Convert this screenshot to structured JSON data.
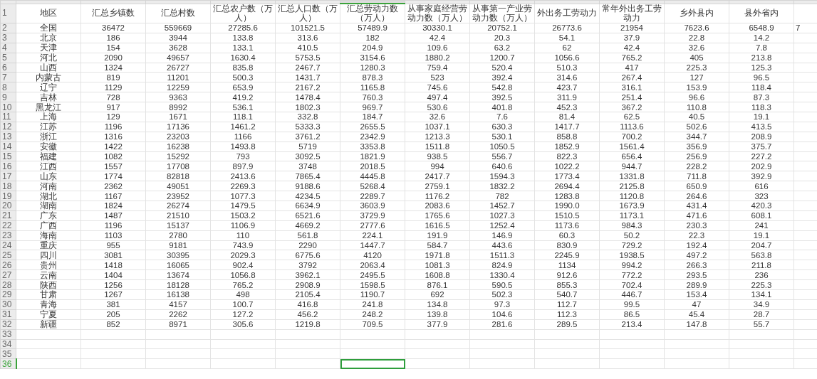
{
  "columns": [
    {
      "title": "地区",
      "selected": false
    },
    {
      "title": "汇总乡镇数",
      "selected": false
    },
    {
      "title": "汇总村数",
      "selected": false
    },
    {
      "title": "汇总农户数（万人）",
      "selected": false
    },
    {
      "title": "汇总人口数（万人）",
      "selected": false
    },
    {
      "title": "汇总劳动力数（万人）",
      "selected": true
    },
    {
      "title": "从事家庭经营劳动力数（万人）",
      "selected": false
    },
    {
      "title": "从事第一产业劳动力数（万人）",
      "selected": false
    },
    {
      "title": "外出务工劳动力",
      "selected": false
    },
    {
      "title": "常年外出务工劳动力",
      "selected": false
    },
    {
      "title": "乡外县内",
      "selected": false
    },
    {
      "title": "县外省内",
      "selected": false
    }
  ],
  "header_row_number": "1",
  "rows": [
    {
      "number": "2",
      "selected": false,
      "cells": [
        "全国",
        "36472",
        "559669",
        "27285.6",
        "101521.5",
        "57489.9",
        "30330.1",
        "20752.1",
        "26773.6",
        "21954",
        "7623.6",
        "6548.9",
        "7"
      ]
    },
    {
      "number": "3",
      "selected": false,
      "cells": [
        "北京",
        "186",
        "3944",
        "133.8",
        "313.6",
        "182",
        "42.4",
        "20.3",
        "54.1",
        "37.9",
        "22.8",
        "14.2"
      ]
    },
    {
      "number": "4",
      "selected": false,
      "cells": [
        "天津",
        "154",
        "3628",
        "133.1",
        "410.5",
        "204.9",
        "109.6",
        "63.2",
        "62",
        "42.4",
        "32.6",
        "7.8"
      ]
    },
    {
      "number": "5",
      "selected": false,
      "cells": [
        "河北",
        "2090",
        "49657",
        "1630.4",
        "5753.5",
        "3154.6",
        "1880.2",
        "1200.7",
        "1056.6",
        "765.2",
        "405",
        "213.8"
      ]
    },
    {
      "number": "6",
      "selected": false,
      "cells": [
        "山西",
        "1324",
        "26727",
        "835.8",
        "2467.7",
        "1280.3",
        "759.4",
        "520.4",
        "510.3",
        "417",
        "225.3",
        "125.3"
      ]
    },
    {
      "number": "7",
      "selected": false,
      "cells": [
        "内蒙古",
        "819",
        "11201",
        "500.3",
        "1431.7",
        "878.3",
        "523",
        "392.4",
        "314.6",
        "267.4",
        "127",
        "96.5"
      ]
    },
    {
      "number": "8",
      "selected": false,
      "cells": [
        "辽宁",
        "1129",
        "12259",
        "653.9",
        "2167.2",
        "1165.8",
        "745.6",
        "542.8",
        "423.7",
        "316.1",
        "153.9",
        "118.4"
      ]
    },
    {
      "number": "9",
      "selected": false,
      "cells": [
        "吉林",
        "728",
        "9363",
        "419.2",
        "1478.4",
        "760.3",
        "497.4",
        "392.5",
        "311.9",
        "251.4",
        "96.6",
        "87.3"
      ]
    },
    {
      "number": "10",
      "selected": false,
      "cells": [
        "黑龙江",
        "917",
        "8992",
        "536.1",
        "1802.3",
        "969.7",
        "530.6",
        "401.8",
        "452.3",
        "367.2",
        "110.8",
        "118.3"
      ]
    },
    {
      "number": "11",
      "selected": false,
      "cells": [
        "上海",
        "129",
        "1671",
        "118.1",
        "332.8",
        "184.7",
        "32.6",
        "7.6",
        "81.4",
        "62.5",
        "40.5",
        "19.1"
      ]
    },
    {
      "number": "12",
      "selected": false,
      "cells": [
        "江苏",
        "1196",
        "17136",
        "1461.2",
        "5333.3",
        "2655.5",
        "1037.1",
        "630.3",
        "1417.7",
        "1113.6",
        "502.6",
        "413.5"
      ]
    },
    {
      "number": "13",
      "selected": false,
      "cells": [
        "浙江",
        "1316",
        "23203",
        "1166",
        "3761.2",
        "2342.9",
        "1213.3",
        "530.1",
        "858.8",
        "700.2",
        "344.7",
        "208.9"
      ]
    },
    {
      "number": "14",
      "selected": false,
      "cells": [
        "安徽",
        "1422",
        "16238",
        "1493.8",
        "5719",
        "3353.8",
        "1511.8",
        "1050.5",
        "1852.9",
        "1561.4",
        "356.9",
        "375.7"
      ]
    },
    {
      "number": "15",
      "selected": false,
      "cells": [
        "福建",
        "1082",
        "15292",
        "793",
        "3092.5",
        "1821.9",
        "938.5",
        "556.7",
        "822.3",
        "656.4",
        "256.9",
        "227.2"
      ]
    },
    {
      "number": "16",
      "selected": false,
      "cells": [
        "江西",
        "1557",
        "17708",
        "897.9",
        "3748",
        "2018.5",
        "994",
        "640.6",
        "1022.2",
        "944.7",
        "228.2",
        "202.9"
      ]
    },
    {
      "number": "17",
      "selected": false,
      "cells": [
        "山东",
        "1774",
        "82818",
        "2413.6",
        "7865.4",
        "4445.8",
        "2417.7",
        "1594.3",
        "1773.4",
        "1331.8",
        "711.8",
        "392.9"
      ]
    },
    {
      "number": "18",
      "selected": false,
      "cells": [
        "河南",
        "2362",
        "49051",
        "2269.3",
        "9188.6",
        "5268.4",
        "2759.1",
        "1832.2",
        "2694.4",
        "2125.8",
        "650.9",
        "616"
      ]
    },
    {
      "number": "19",
      "selected": false,
      "cells": [
        "湖北",
        "1167",
        "23952",
        "1077.3",
        "4234.5",
        "2289.7",
        "1176.2",
        "782",
        "1283.8",
        "1120.8",
        "264.6",
        "323"
      ]
    },
    {
      "number": "20",
      "selected": false,
      "cells": [
        "湖南",
        "1824",
        "26274",
        "1479.5",
        "6634.9",
        "3603.9",
        "2083.6",
        "1452.7",
        "1990.0",
        "1673.9",
        "431.4",
        "420.3"
      ]
    },
    {
      "number": "21",
      "selected": false,
      "cells": [
        "广东",
        "1487",
        "21510",
        "1503.2",
        "6521.6",
        "3729.9",
        "1765.6",
        "1027.3",
        "1510.5",
        "1173.1",
        "471.6",
        "608.1"
      ]
    },
    {
      "number": "22",
      "selected": false,
      "cells": [
        "广西",
        "1196",
        "15137",
        "1106.9",
        "4669.2",
        "2777.6",
        "1616.5",
        "1252.4",
        "1173.6",
        "984.3",
        "230.3",
        "241"
      ]
    },
    {
      "number": "23",
      "selected": false,
      "cells": [
        "海南",
        "1103",
        "2780",
        "110",
        "561.8",
        "224.1",
        "191.9",
        "146.9",
        "60.3",
        "50.2",
        "22.3",
        "19.1"
      ]
    },
    {
      "number": "24",
      "selected": false,
      "cells": [
        "重庆",
        "955",
        "9181",
        "743.9",
        "2290",
        "1447.7",
        "584.7",
        "443.6",
        "830.9",
        "729.2",
        "192.4",
        "204.7"
      ]
    },
    {
      "number": "25",
      "selected": false,
      "cells": [
        "四川",
        "3081",
        "30395",
        "2029.3",
        "6775.6",
        "4120",
        "1971.8",
        "1511.3",
        "2245.9",
        "1938.5",
        "497.2",
        "563.8"
      ]
    },
    {
      "number": "26",
      "selected": false,
      "cells": [
        "贵州",
        "1418",
        "16065",
        "902.4",
        "3792",
        "2063.4",
        "1081.3",
        "824.9",
        "1134",
        "994.2",
        "266.3",
        "211.8"
      ]
    },
    {
      "number": "27",
      "selected": false,
      "cells": [
        "云南",
        "1404",
        "13674",
        "1056.8",
        "3962.1",
        "2495.5",
        "1608.8",
        "1330.4",
        "912.6",
        "772.2",
        "293.5",
        "236"
      ]
    },
    {
      "number": "28",
      "selected": false,
      "cells": [
        "陕西",
        "1256",
        "18128",
        "765.2",
        "2908.9",
        "1598.5",
        "876.1",
        "590.5",
        "855.3",
        "702.4",
        "289.9",
        "225.3"
      ]
    },
    {
      "number": "29",
      "selected": false,
      "cells": [
        "甘肃",
        "1267",
        "16138",
        "498",
        "2105.4",
        "1190.7",
        "692",
        "502.3",
        "540.7",
        "446.7",
        "153.4",
        "134.1"
      ]
    },
    {
      "number": "30",
      "selected": false,
      "cells": [
        "青海",
        "381",
        "4157",
        "100.7",
        "416.8",
        "241.8",
        "134.8",
        "97.3",
        "112.7",
        "99.5",
        "47",
        "34.9"
      ]
    },
    {
      "number": "31",
      "selected": false,
      "cells": [
        "宁夏",
        "205",
        "2262",
        "127.2",
        "456.2",
        "248.2",
        "139.8",
        "104.6",
        "112.3",
        "86.5",
        "45.4",
        "28.7"
      ]
    },
    {
      "number": "32",
      "selected": false,
      "cells": [
        "新疆",
        "852",
        "8971",
        "305.6",
        "1219.8",
        "709.5",
        "377.9",
        "281.6",
        "289.5",
        "213.4",
        "147.8",
        "55.7"
      ]
    },
    {
      "number": "33",
      "selected": false,
      "cells": []
    },
    {
      "number": "34",
      "selected": false,
      "cells": []
    },
    {
      "number": "35",
      "selected": false,
      "cells": []
    },
    {
      "number": "36",
      "selected": true,
      "cells": []
    }
  ]
}
